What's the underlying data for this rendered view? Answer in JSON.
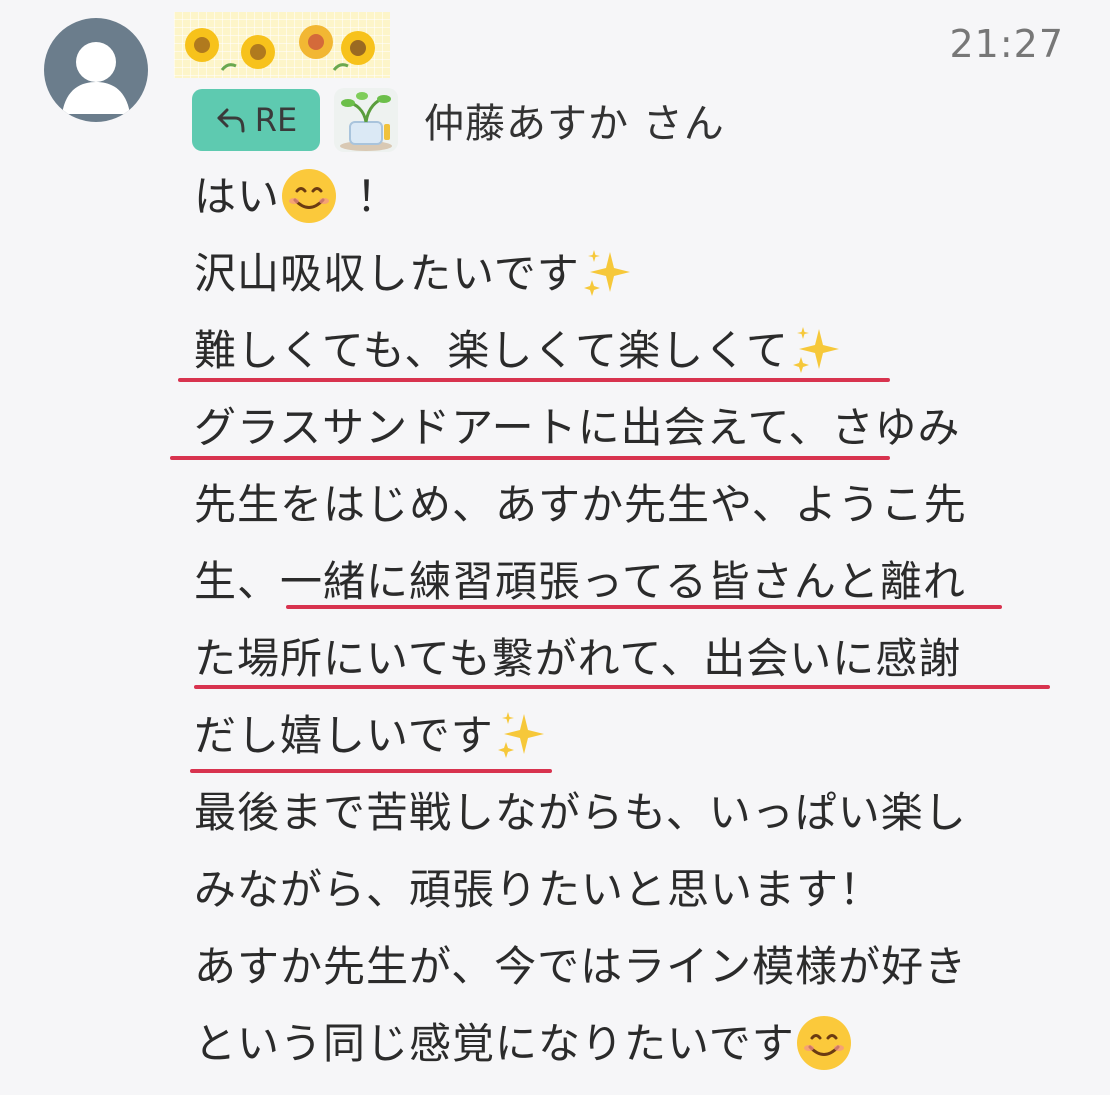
{
  "header": {
    "time": "21:27"
  },
  "reply": {
    "badge_label": "RE",
    "to_name": "仲藤あすか さん"
  },
  "message": {
    "lines": [
      "はい",
      "沢山吸収したいです",
      "難しくても、楽しくて楽しくて",
      "グラスサンドアートに出会えて、さゆみ",
      "先生をはじめ、あすか先生や、ようこ先",
      "生、一緒に練習頑張ってる皆さんと離れ",
      "た場所にいても繋がれて、出会いに感謝",
      "だし嬉しいです",
      "最後まで苦戦しながらも、いっぱい楽し",
      "みながら、頑張りたいと思います！",
      "あすか先生が、今ではライン模様が好き",
      "という同じ感覚になりたいです"
    ],
    "line1_suffix": "！"
  },
  "colors": {
    "underline": "#d8334f",
    "re_badge": "#5ecab0",
    "avatar": "#6b7d8c"
  }
}
